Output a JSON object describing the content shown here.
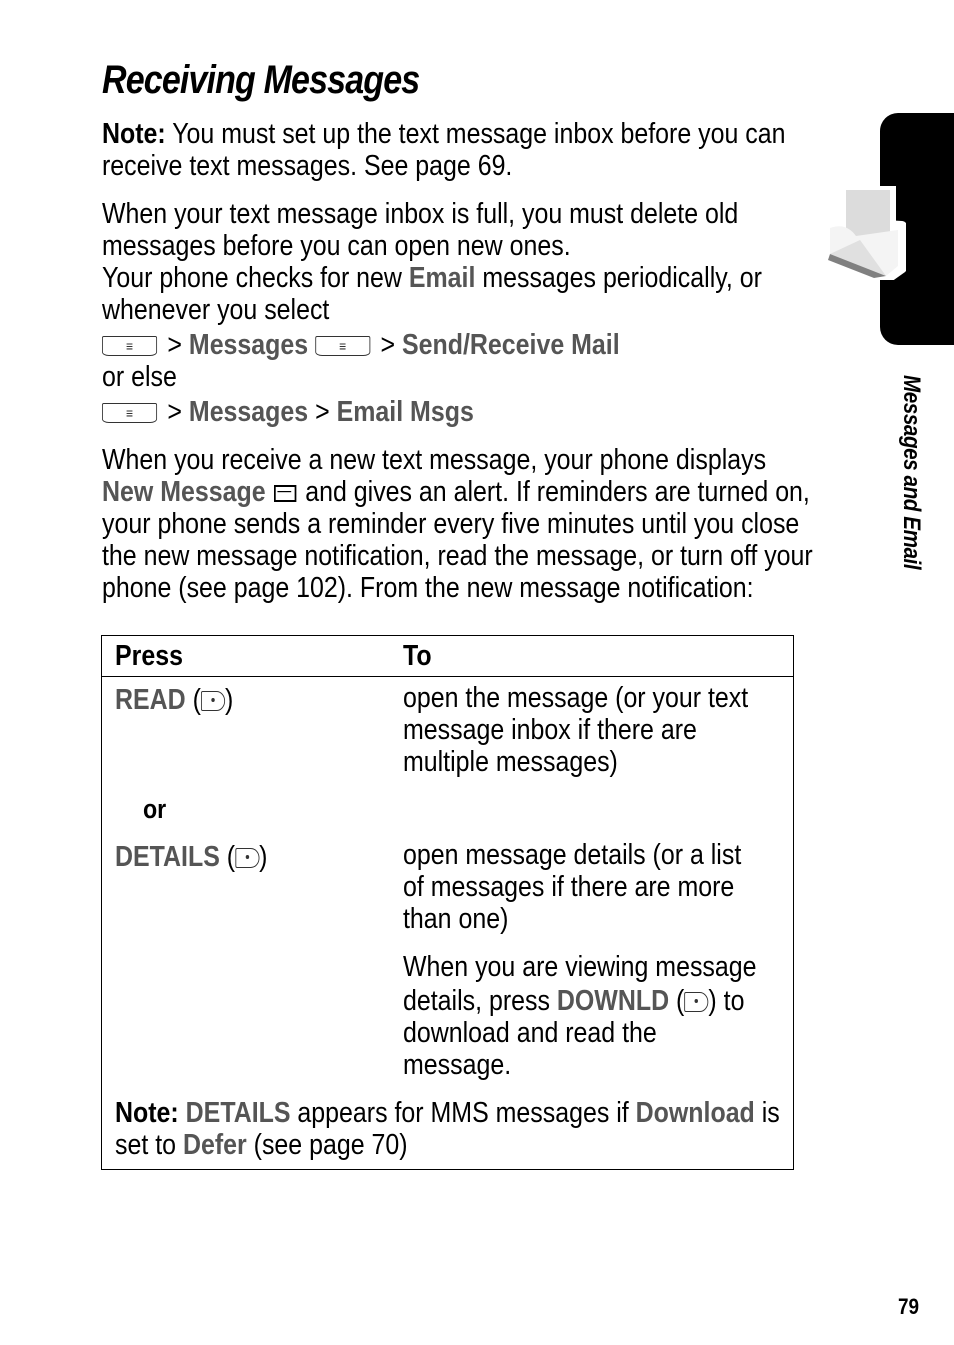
{
  "page": {
    "title": "Receiving Messages",
    "section_tab": "Messages and Email",
    "page_number": "79"
  },
  "intro": {
    "note_label": "Note:",
    "note_text_1": " You must set up the text message inbox before you can",
    "note_text_2": "receive text messages. See page 69.",
    "full_1": "When your text message inbox is full, you must delete old",
    "full_2": "messages before you can open new ones.",
    "checks_pre": "Your phone checks for new ",
    "checks_email": "Email",
    "checks_post": " messages periodically, or",
    "checks_2": "whenever you select",
    "path1": [
      {
        "label": "Messages"
      },
      {
        "label": "Send/Receive Mail"
      }
    ],
    "or_else": "or else",
    "path2": [
      {
        "label": "Messages"
      },
      {
        "label": "Email Msgs"
      }
    ],
    "sep": ">",
    "receive_1": "When you receive a new text message, your phone displays",
    "receive_new_message": "New Message",
    "receive_2": " and gives an alert. If reminders are turned on,",
    "receive_3": "your phone sends a reminder every five minutes until you close",
    "receive_4": "the new message notification, read the message, or turn off your",
    "receive_5": "phone (see page 102). From the new message notification:"
  },
  "table": {
    "headers": [
      "Press",
      "To"
    ],
    "rows": [
      {
        "key": "READ",
        "desc": [
          "open the message (or your text",
          "message inbox if there are",
          "multiple messages)"
        ]
      },
      {
        "or": "or"
      },
      {
        "key": "DETAILS",
        "desc": [
          "open message details (or a list",
          "of messages if there are more",
          "than one)"
        ]
      }
    ],
    "extra": {
      "line1": "When you are viewing message",
      "line2_pre": "details, press ",
      "line2_key": "DOWNLD",
      "line2_post": ") to",
      "line3": "download and read the",
      "line4": "message."
    },
    "note": {
      "label": "Note:",
      "details": "DETAILS",
      "t1": " appears for MMS messages if ",
      "download": "Download",
      "t2": " is",
      "t3": "set to ",
      "defer": "Defer",
      "t4": " (see page 70)"
    }
  }
}
